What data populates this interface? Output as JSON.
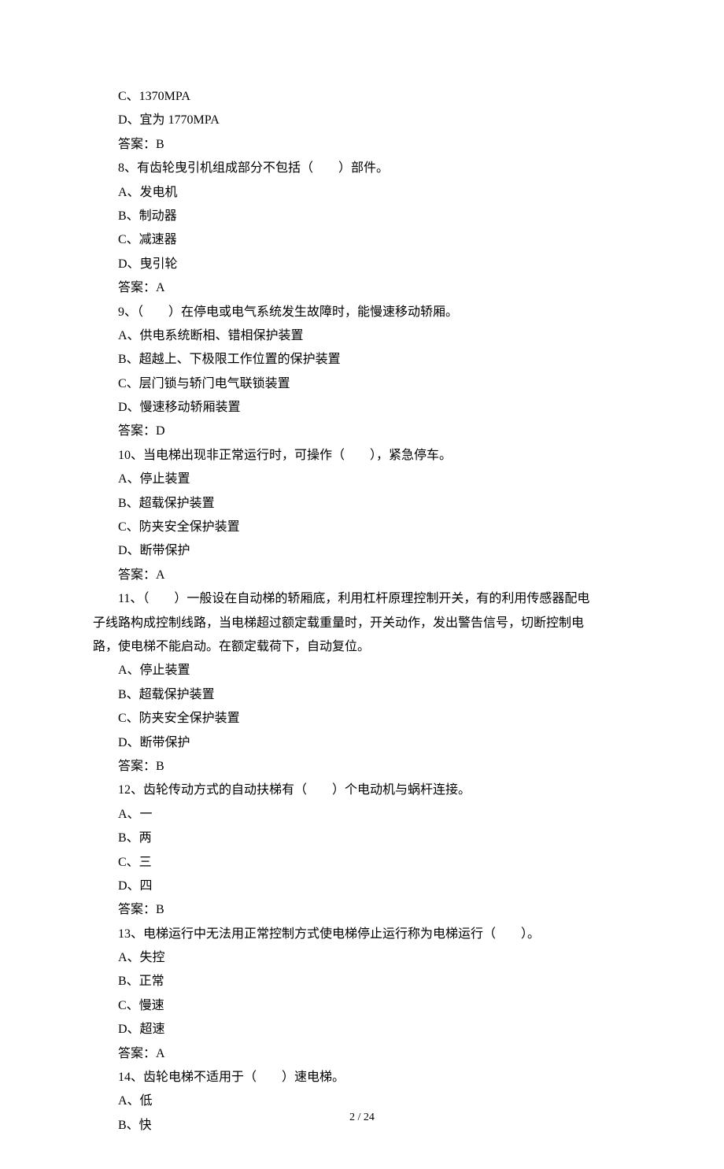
{
  "lines": [
    "C、1370MPA",
    "D、宜为 1770MPA",
    "答案：B",
    "8、有齿轮曳引机组成部分不包括（　　）部件。",
    "A、发电机",
    "B、制动器",
    "C、减速器",
    "D、曳引轮",
    "答案：A",
    "9、（　　）在停电或电气系统发生故障时，能慢速移动轿厢。",
    "A、供电系统断相、错相保护装置",
    "B、超越上、下极限工作位置的保护装置",
    "C、层门锁与轿门电气联锁装置",
    "D、慢速移动轿厢装置",
    "答案：D",
    "10、当电梯出现非正常运行时，可操作（　　），紧急停车。",
    "A、停止装置",
    "B、超载保护装置",
    "C、防夹安全保护装置",
    "D、断带保护",
    "答案：A"
  ],
  "q11": {
    "l1": "11、（　　）一般设在自动梯的轿厢底，利用杠杆原理控制开关，有的利用传感器配电",
    "l2": "子线路构成控制线路，当电梯超过额定载重量时，开关动作，发出警告信号，切断控制电",
    "l3": "路，使电梯不能启动。在额定载荷下，自动复位。"
  },
  "lines2": [
    "A、停止装置",
    "B、超载保护装置",
    "C、防夹安全保护装置",
    "D、断带保护",
    "答案：B",
    "12、齿轮传动方式的自动扶梯有（　　）个电动机与蜗杆连接。",
    "A、一",
    "B、两",
    "C、三",
    "D、四",
    "答案：B",
    "13、电梯运行中无法用正常控制方式使电梯停止运行称为电梯运行（　　）。",
    "A、失控",
    "B、正常",
    "C、慢速",
    "D、超速",
    "答案：A",
    "14、齿轮电梯不适用于（　　）速电梯。",
    "A、低",
    "B、快"
  ],
  "footer": "2 / 24"
}
